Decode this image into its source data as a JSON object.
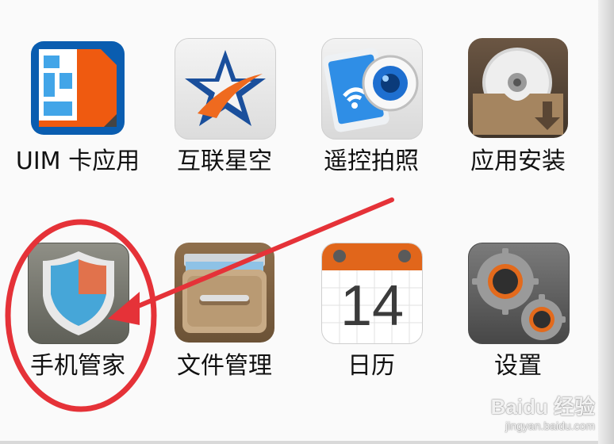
{
  "apps": [
    {
      "id": "uim",
      "label": "UIM 卡应用",
      "icon": "sim-card-icon",
      "colors": {
        "body": "#ef5a10",
        "border": "#0a5db0"
      }
    },
    {
      "id": "internet",
      "label": "互联星空",
      "icon": "star-icon",
      "colors": {
        "star": "#1a4f9c",
        "accent": "#ef6a1f"
      }
    },
    {
      "id": "remote",
      "label": "遥控拍照",
      "icon": "phone-camera-icon",
      "colors": {
        "screen": "#2f8ee6",
        "lens": "#1e6fd0"
      }
    },
    {
      "id": "install",
      "label": "应用安装",
      "icon": "disc-box-icon",
      "colors": {
        "box": "#a58560"
      }
    },
    {
      "id": "manager",
      "label": "手机管家",
      "icon": "shield-icon",
      "colors": {
        "blue": "#46a6d8",
        "orange": "#e1724c"
      }
    },
    {
      "id": "files",
      "label": "文件管理",
      "icon": "file-drawer-icon",
      "colors": {
        "drawer": "#9b7650"
      }
    },
    {
      "id": "calendar",
      "label": "日历",
      "icon": "calendar-icon",
      "date": "14",
      "colors": {
        "binding": "#e1661b"
      }
    },
    {
      "id": "settings",
      "label": "设置",
      "icon": "gears-icon",
      "colors": {
        "gear": "#8a8a8a",
        "ring": "#e36a1c"
      }
    }
  ],
  "annotation": {
    "circle_color": "#e53238",
    "arrow_color": "#e53238",
    "target": "manager"
  },
  "watermark": {
    "brand": "Baidu 经验",
    "url": "jingyan.baidu.com"
  }
}
